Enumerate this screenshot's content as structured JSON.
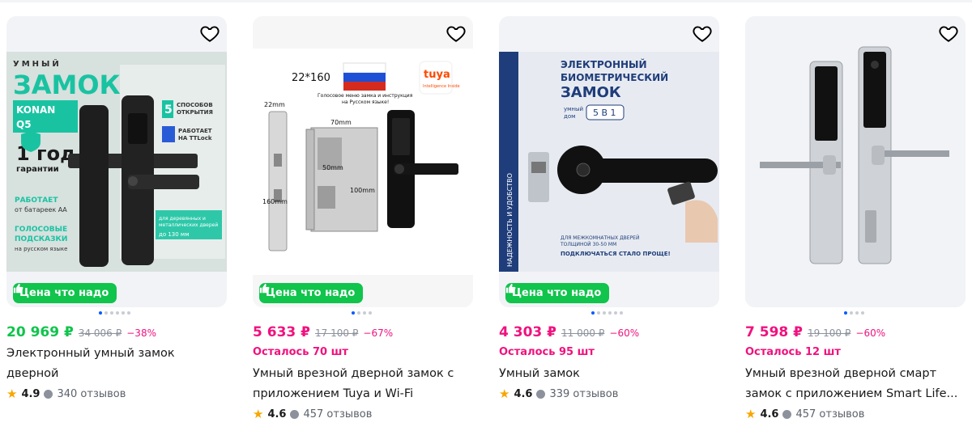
{
  "badge_label": "Цена что надо",
  "cards": [
    {
      "price": "20 969 ₽",
      "old_price": "34 006 ₽",
      "discount": "−38%",
      "stock": "",
      "title_lines": [
        "Электронный умный замок",
        "дверной"
      ],
      "rating": "4.9",
      "reviews": "340 отзывов",
      "price_color": "#10c44c",
      "image_text": {
        "brand_top": "УМНЫЙ",
        "brand_big": "ЗАМОК",
        "model": "KONAN Q5",
        "ways_num": "5",
        "ways": "СПОСОБОВ ОТКРЫТИЯ",
        "ttlock": "РАБОТАЕТ НА TTLock",
        "year": "1 год",
        "warranty": "гарантии",
        "battery_title": "РАБОТАЕТ",
        "battery": "от батареек АА",
        "voice": "ГОЛОСОВЫЕ ПОДСКАЗКИ",
        "voice_lang": "на русском языке",
        "doors": "для деревянных и металлических дверей",
        "doors_size": "до 130 мм"
      }
    },
    {
      "price": "5 633 ₽",
      "old_price": "17 100 ₽",
      "discount": "−67%",
      "stock": "Осталось 70 шт",
      "title_lines": [
        "Умный врезной дверной замок с",
        "приложением Tuya и Wi-Fi"
      ],
      "rating": "4.6",
      "reviews": "457 отзывов",
      "price_color": "#f1117e",
      "image_text": {
        "size": "22*160",
        "menu_note": "Голосовое меню замка и инструкция на Русском языке!",
        "tuya": "tuya",
        "tuya_sub": "Intelligence Inside",
        "d22": "22mm",
        "d70": "70mm",
        "d50": "50mm",
        "d100": "100mm",
        "d160": "160mm"
      }
    },
    {
      "price": "4 303 ₽",
      "old_price": "11 000 ₽",
      "discount": "−60%",
      "stock": "Осталось 95 шт",
      "title_lines": [
        "Умный замок"
      ],
      "rating": "4.6",
      "reviews": "339 отзывов",
      "price_color": "#f1117e",
      "image_text": {
        "side": "НАДЕЖНОСТЬ И УДОБСТВО",
        "line1": "ЭЛЕКТРОННЫЙ",
        "line2": "БИОМЕТРИЧЕСКИЙ",
        "line3": "ЗАМОК",
        "home": "умный дом",
        "fiveinone": "5 В 1",
        "doors1": "ДЛЯ МЕЖКОМНАТНЫХ ДВЕРЕЙ",
        "doors2": "ТОЛЩИНОЙ 30-50 ММ",
        "easier": "ПОДКЛЮЧАТЬСЯ СТАЛО ПРОЩЕ!"
      }
    },
    {
      "price": "7 598 ₽",
      "old_price": "19 100 ₽",
      "discount": "−60%",
      "stock": "Осталось 12 шт",
      "title_lines": [
        "Умный врезной дверной смарт",
        "замок с приложением Smart Life..."
      ],
      "rating": "4.6",
      "reviews": "457 отзывов",
      "price_color": "#f1117e"
    }
  ],
  "colors": {
    "badge_green": "#10c44c",
    "price_pink": "#f1117e",
    "price_green": "#10c44c",
    "star": "#f7a600",
    "dot_active": "#005bff"
  }
}
